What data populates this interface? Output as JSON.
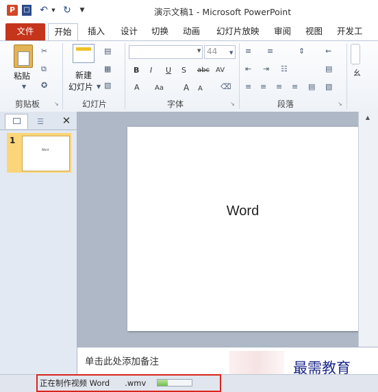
{
  "window": {
    "title": "演示文稿1 - Microsoft PowerPoint"
  },
  "quick_access": {
    "app_icon": "P",
    "save_icon": "save-icon",
    "undo_icon": "undo-icon",
    "redo_icon": "redo-icon"
  },
  "tabs": [
    {
      "label": "文件"
    },
    {
      "label": "开始"
    },
    {
      "label": "插入"
    },
    {
      "label": "设计"
    },
    {
      "label": "切换"
    },
    {
      "label": "动画"
    },
    {
      "label": "幻灯片放映"
    },
    {
      "label": "审阅"
    },
    {
      "label": "视图"
    },
    {
      "label": "开发工"
    }
  ],
  "ribbon": {
    "groups": [
      {
        "label": "剪贴板"
      },
      {
        "label": "幻灯片"
      },
      {
        "label": "字体"
      },
      {
        "label": "段落"
      }
    ],
    "paste_label": "粘贴",
    "new_slide_line1": "新建",
    "new_slide_line2": "幻灯片",
    "font_size": "44",
    "format_buttons": [
      "B",
      "I",
      "U",
      "S",
      "abc",
      "AV"
    ],
    "font_row2": [
      "A",
      "Aa",
      "A",
      "A"
    ],
    "right_partial": "幺"
  },
  "slides_panel": {
    "slide_number": "1",
    "thumb_text": "Word"
  },
  "slide": {
    "text": "Word"
  },
  "notes": {
    "placeholder": "单击此处添加备注"
  },
  "status": {
    "text": "正在制作视频 Word",
    "filename_suffix": ".wmv",
    "progress": 0.3
  },
  "watermark": {
    "text": "最需教育"
  },
  "colors": {
    "file_tab": "#c5351b",
    "status_highlight": "#d8241c",
    "selection": "#fbd57a",
    "watermark": "#1c2a8c"
  }
}
